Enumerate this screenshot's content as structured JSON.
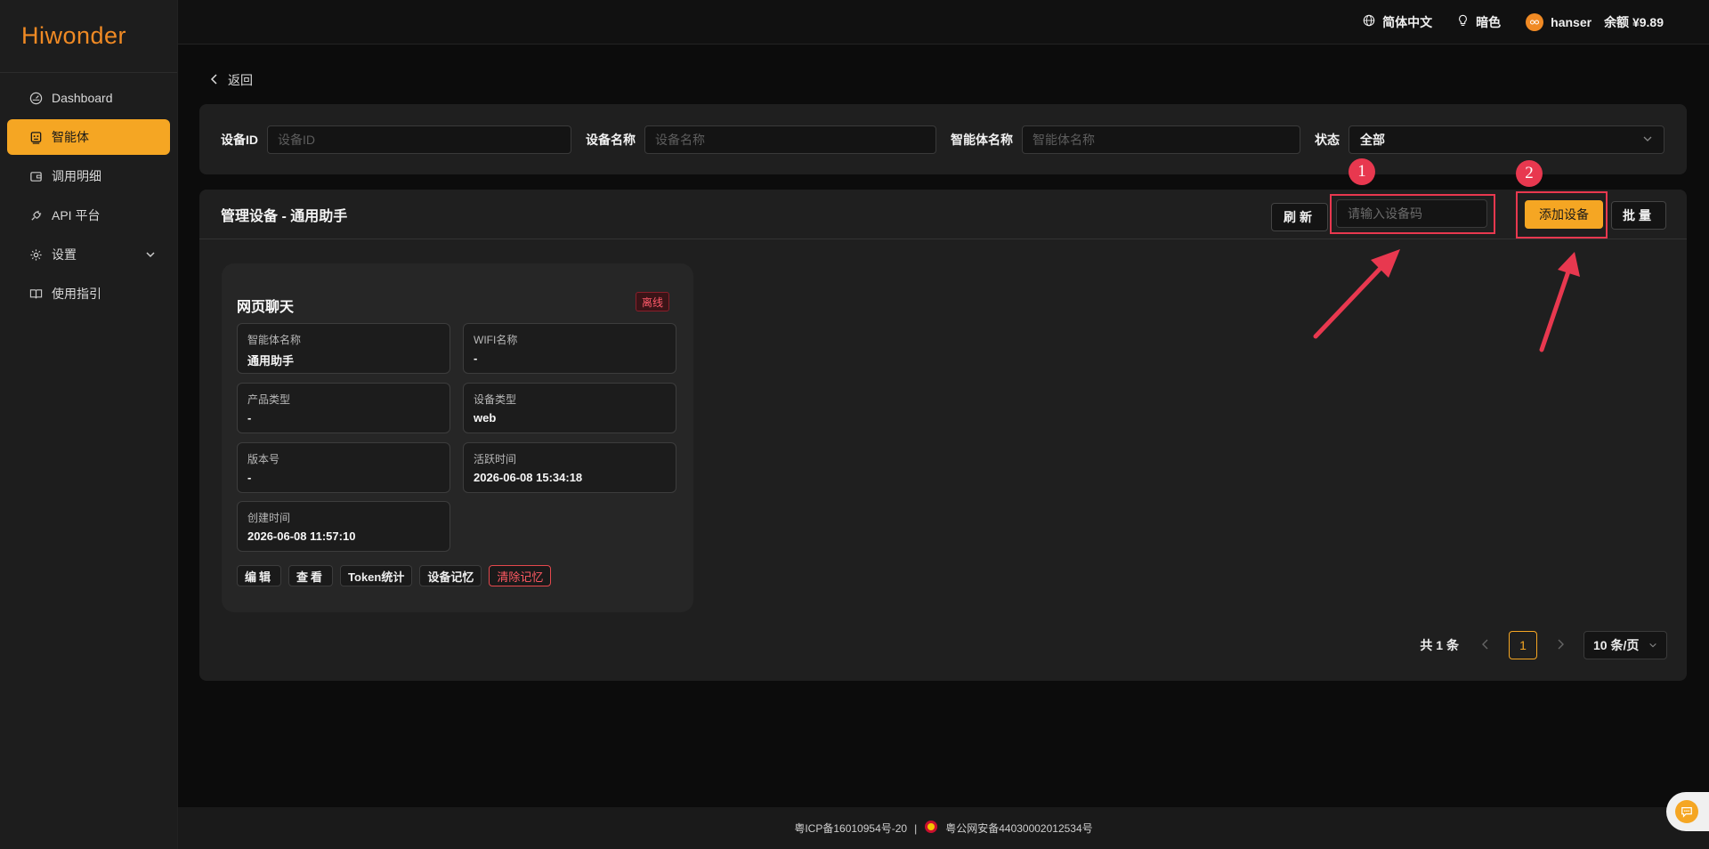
{
  "brand": {
    "logo_text": "Hiwonder",
    "accent": "#f5a623"
  },
  "sidebar": {
    "items": [
      {
        "label": "Dashboard",
        "icon": "dashboard-icon"
      },
      {
        "label": "智能体",
        "icon": "robot-icon",
        "active": true
      },
      {
        "label": "调用明细",
        "icon": "wallet-icon"
      },
      {
        "label": "API 平台",
        "icon": "plug-icon"
      },
      {
        "label": "设置",
        "icon": "gear-icon",
        "has_submenu": true
      },
      {
        "label": "使用指引",
        "icon": "book-icon"
      }
    ]
  },
  "topbar": {
    "language": "简体中文",
    "theme": "暗色",
    "username": "hanser",
    "balance": "余额 ¥9.89"
  },
  "nav": {
    "back_label": "返回"
  },
  "filters": {
    "device_id": {
      "label": "设备ID",
      "placeholder": "设备ID"
    },
    "device_name": {
      "label": "设备名称",
      "placeholder": "设备名称"
    },
    "agent_name": {
      "label": "智能体名称",
      "placeholder": "智能体名称"
    },
    "status": {
      "label": "状态",
      "value": "全部"
    }
  },
  "panel": {
    "title": "管理设备 - 通用助手",
    "refresh_label": "刷新",
    "code_placeholder": "请输入设备码",
    "add_label": "添加设备",
    "batch_label": "批量",
    "annotations": [
      "1",
      "2"
    ]
  },
  "device_card": {
    "title": "网页聊天",
    "status": "离线",
    "fields": [
      {
        "label": "智能体名称",
        "value": "通用助手"
      },
      {
        "label": "WIFI名称",
        "value": "-"
      },
      {
        "label": "产品类型",
        "value": "-"
      },
      {
        "label": "设备类型",
        "value": "web"
      },
      {
        "label": "版本号",
        "value": "-"
      },
      {
        "label": "活跃时间",
        "value": "2026-06-08 15:34:18"
      },
      {
        "label": "创建时间",
        "value": "2026-06-08 11:57:10"
      }
    ],
    "actions": {
      "edit": "编辑",
      "view": "查看",
      "token": "Token统计",
      "memory": "设备记忆",
      "clear": "清除记忆"
    }
  },
  "pagination": {
    "total": "共 1 条",
    "current": "1",
    "page_size": "10 条/页"
  },
  "footer": {
    "icp": "粤ICP备16010954号-20",
    "separator": "|",
    "police": "粤公网安备44030002012534号"
  }
}
